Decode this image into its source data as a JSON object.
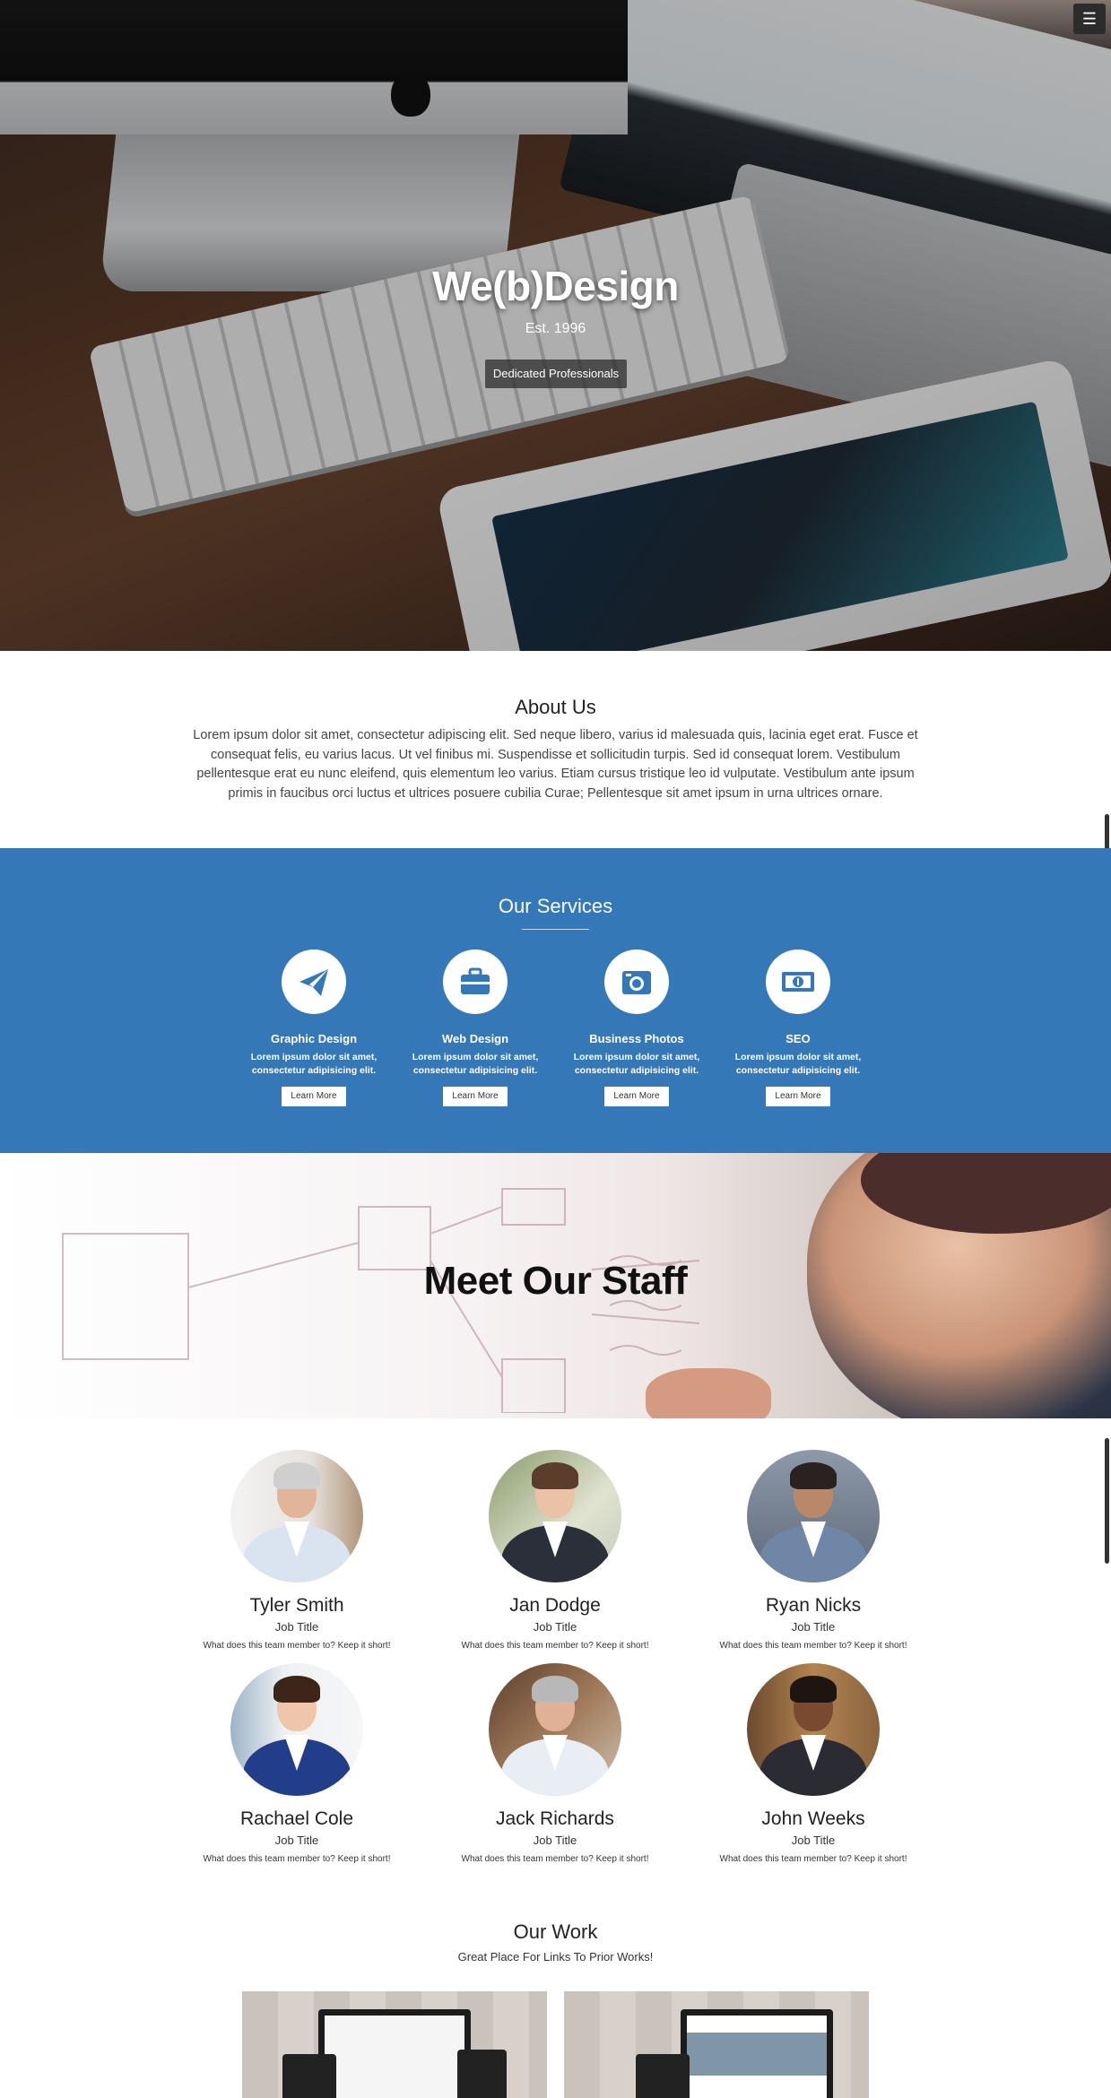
{
  "hero": {
    "title": "We(b)Design",
    "subtitle": "Est. 1996",
    "button_label": "Dedicated Professionals",
    "menu_icon": "menu-icon"
  },
  "about": {
    "title": "About Us",
    "text": "Lorem ipsum dolor sit amet, consectetur adipiscing elit. Sed neque libero, varius id malesuada quis, lacinia eget erat. Fusce et consequat felis, eu varius lacus. Ut vel finibus mi. Suspendisse et sollicitudin turpis. Sed id consequat lorem. Vestibulum pellentesque erat eu nunc eleifend, quis elementum leo varius. Etiam cursus tristique leo id vulputate. Vestibulum ante ipsum primis in faucibus orci luctus et ultrices posuere cubilia Curae; Pellentesque sit amet ipsum in urna ultrices ornare."
  },
  "services": {
    "title": "Our Services",
    "background": "#3478b8",
    "items": [
      {
        "icon": "paper-plane-icon",
        "name": "Graphic Design",
        "desc": "Lorem ipsum dolor sit amet, consectetur adipisicing elit.",
        "button": "Learn More"
      },
      {
        "icon": "briefcase-icon",
        "name": "Web Design",
        "desc": "Lorem ipsum dolor sit amet, consectetur adipisicing elit.",
        "button": "Learn More"
      },
      {
        "icon": "camera-icon",
        "name": "Business Photos",
        "desc": "Lorem ipsum dolor sit amet, consectetur adipisicing elit.",
        "button": "Learn More"
      },
      {
        "icon": "money-icon",
        "name": "SEO",
        "desc": "Lorem ipsum dolor sit amet, consectetur adipisicing elit.",
        "button": "Learn More"
      }
    ]
  },
  "staff": {
    "title": "Meet Our Staff",
    "members": [
      {
        "name": "Tyler Smith",
        "job": "Job Title",
        "desc": "What does this team member to? Keep it short!"
      },
      {
        "name": "Jan Dodge",
        "job": "Job Title",
        "desc": "What does this team member to? Keep it short!"
      },
      {
        "name": "Ryan Nicks",
        "job": "Job Title",
        "desc": "What does this team member to? Keep it short!"
      },
      {
        "name": "Rachael Cole",
        "job": "Job Title",
        "desc": "What does this team member to? Keep it short!"
      },
      {
        "name": "Jack Richards",
        "job": "Job Title",
        "desc": "What does this team member to? Keep it short!"
      },
      {
        "name": "John Weeks",
        "job": "Job Title",
        "desc": "What does this team member to? Keep it short!"
      }
    ]
  },
  "work": {
    "title": "Our Work",
    "subtitle": "Great Place For Links To Prior Works!"
  }
}
